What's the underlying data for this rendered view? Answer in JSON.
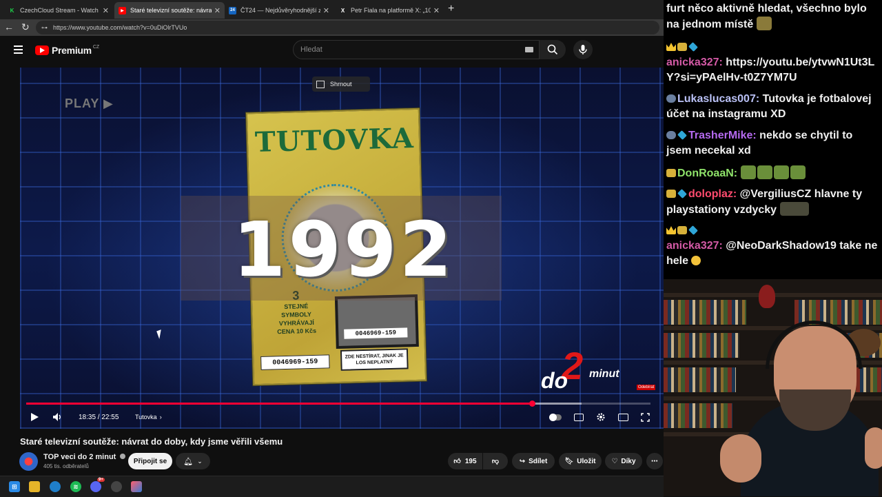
{
  "browser": {
    "tabs": [
      {
        "title": "CzechCloud Stream - Watch Live o",
        "fav": "K",
        "favColor": "#1fd34a",
        "active": false
      },
      {
        "title": "Staré televizní soutěže: návrat",
        "fav": "▶",
        "favColor": "#ff0000",
        "active": true
      },
      {
        "title": "ČT24 — Nejdůvěryhodnější zpravo",
        "fav": "24",
        "favColor": "#1565c0",
        "active": false
      },
      {
        "title": "Petr Fiala na platformě X: „100 dní",
        "fav": "X",
        "favColor": "#000000",
        "active": false
      }
    ],
    "new_tab": "+",
    "url": "https://www.youtube.com/watch?v=0uDiOlrTVUo"
  },
  "youtube": {
    "logo_text": "Premium",
    "region": "CZ",
    "search_placeholder": "Hledat"
  },
  "video": {
    "overlay_play": "PLAY ▶",
    "summary_label": "Shrnout",
    "year": "1992",
    "ticket": {
      "title": "TUTOVKA",
      "rules": [
        "3",
        "STEJNÉ",
        "SYMBOLY",
        "VYHRÁVAJÍ",
        "CENA 10 Kčs"
      ],
      "code": "0046969-159",
      "note": "ZDE NESTÍRAT, JINAK JE LOS NEPLATNÝ"
    },
    "channel_logo": {
      "do": "do",
      "two": "2",
      "minut": "minut"
    },
    "subscribe_badge": "Odebírat",
    "time": "18:35 / 22:55",
    "progress": 0.81,
    "buffered": 0.89,
    "chapter": "Tutovka",
    "title": "Staré televizní soutěže: návrat do doby, kdy jsme věřili všemu"
  },
  "channel": {
    "name": "TOP veci do 2 minut",
    "subscribers": "405 tis. odběratelů",
    "join": "Připojit se"
  },
  "actions": {
    "likes": "195",
    "share": "Sdílet",
    "save": "Uložit",
    "thanks": "Díky",
    "more": "⋯"
  },
  "chat": {
    "first_line_1": "furt něco aktivně hledat, všechno bylo",
    "first_line_2": "na jednom místě",
    "messages": [
      {
        "user": "anicka327",
        "color": "#d45aa6",
        "text": "https://youtu.be/ytvwN1Ut3LY?si=yPAelHv-t0Z7YM7U"
      },
      {
        "user": "Lukaslucas007",
        "color": "#b9c0f5",
        "text": "Tutovka je fotbalovej účet na instagramu XD"
      },
      {
        "user": "TrasherMike",
        "color": "#b56af0",
        "text": "nekdo se chytil to jsem necekal xd"
      },
      {
        "user": "DonRoaaN",
        "color": "#8fe36a",
        "text": ""
      },
      {
        "user": "doloplaz",
        "color": "#ff4b6e",
        "text": "@VergiliusCZ hlavne ty playstationy vzdycky"
      },
      {
        "user": "anicka327",
        "color": "#d45aa6",
        "text": "@NeoDarkShadow19 take ne hele"
      }
    ]
  },
  "taskbar": {
    "badge_count": "9+"
  }
}
